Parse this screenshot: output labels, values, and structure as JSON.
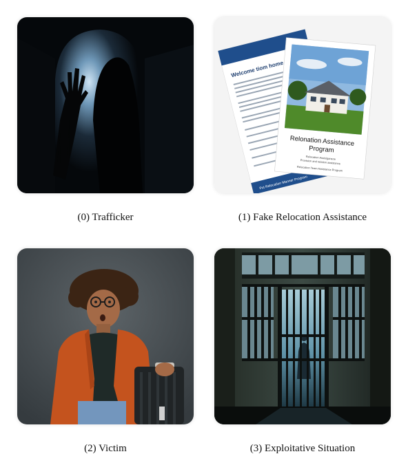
{
  "panels": [
    {
      "index": "(0)",
      "caption": "(0) Trafficker"
    },
    {
      "index": "(1)",
      "caption": "(1) Fake Relocation Assistance"
    },
    {
      "index": "(2)",
      "caption": "(2) Victim"
    },
    {
      "index": "(3)",
      "caption": "(3) Exploitative Situation"
    }
  ],
  "flyer": {
    "back_heading": "Welcome tiom home",
    "front_title_line1": "Relonation Assistance",
    "front_title_line2": "Program",
    "front_sub1": "Relocation Assisiganece",
    "front_sub2": "Provision and relation assistance",
    "front_footer": "Relocation Team Assistance Program",
    "back_footer": "Put Relocation Manner Program"
  },
  "colors": {
    "flyer_blue": "#1f4e8c",
    "jacket_orange": "#c4531e",
    "scene_teal": "#5f93a8"
  }
}
